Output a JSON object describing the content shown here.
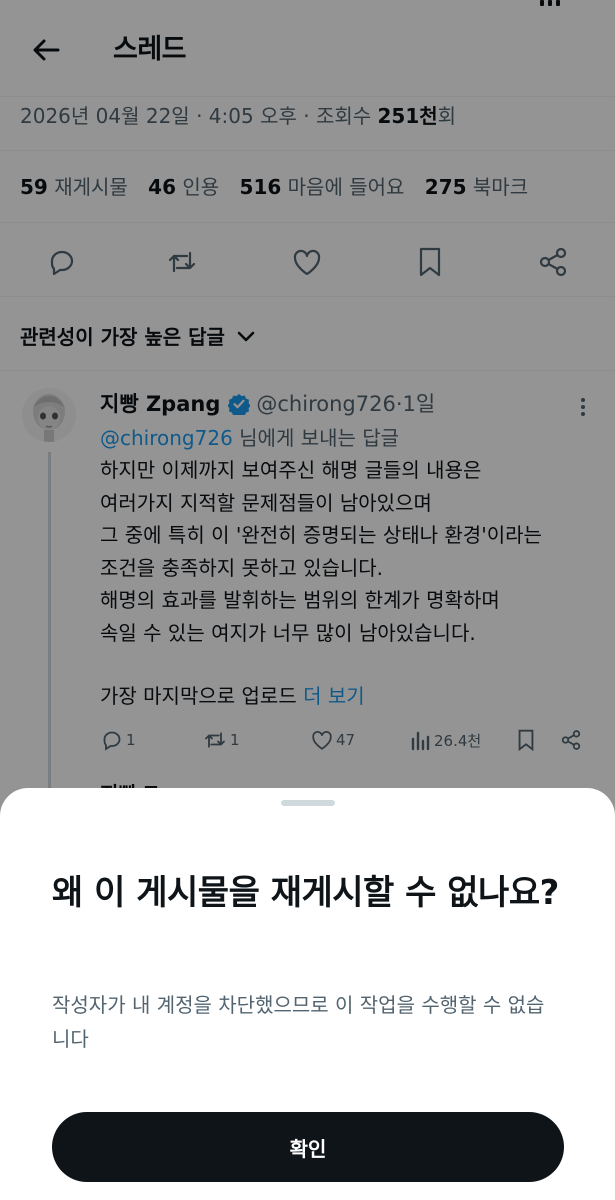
{
  "header": {
    "title": "스레드",
    "back_icon": "arrow-left-icon"
  },
  "post_meta": {
    "date": "2026년 04월 22일",
    "separator": " · ",
    "time": "4:05 오후",
    "views_prefix": "조회수 ",
    "views_count": "251천",
    "views_suffix": "회"
  },
  "stats": [
    {
      "count": "59",
      "label": "재게시물"
    },
    {
      "count": "46",
      "label": "인용"
    },
    {
      "count": "516",
      "label": "마음에 들어요"
    },
    {
      "count": "275",
      "label": "북마크"
    }
  ],
  "actions": {
    "icons": [
      "reply-icon",
      "repost-icon",
      "like-icon",
      "bookmark-icon",
      "share-icon"
    ]
  },
  "sort": {
    "label": "관련성이 가장 높은 답글",
    "icon": "chevron-down-icon"
  },
  "reply": {
    "name": "지빵 Zpang",
    "handle": "@chirong726",
    "dot": " · ",
    "age": "1일",
    "replying_mention": "@chirong726",
    "replying_suffix": " 님에게 보내는 답글",
    "lines": [
      "하지만 이제까지 보여주신 해명 글들의 내용은",
      "여러가지 지적할 문제점들이 남아있으며",
      "그 중에 특히 이 '완전히 증명되는 상태나 환경'이라는",
      "조건을 충족하지 못하고 있습니다.",
      "해명의 효과를 발휘하는 범위의 한계가 명확하며",
      "속일 수 있는 여지가 너무 많이 남아있습니다."
    ],
    "last_line": "가장 마지막으로 업로드 ",
    "more_link": "더 보기",
    "reply_count": "1",
    "repost_count": "1",
    "like_count": "47",
    "view_count": "26.4천"
  },
  "next_reply": {
    "name_partial": "지빵 Z"
  },
  "sheet": {
    "title": "왜 이 게시물을 재게시할 수 없나요?",
    "message": "작성자가 내 계정을 차단했으므로 이 작업을 수행할 수 없습니다",
    "confirm_label": "확인"
  },
  "colors": {
    "accent": "#1d9bf0",
    "text": "#0f1419",
    "secondary": "#536471",
    "scrim": "rgba(0,0,0,0.42)",
    "button": "#0f1419"
  }
}
